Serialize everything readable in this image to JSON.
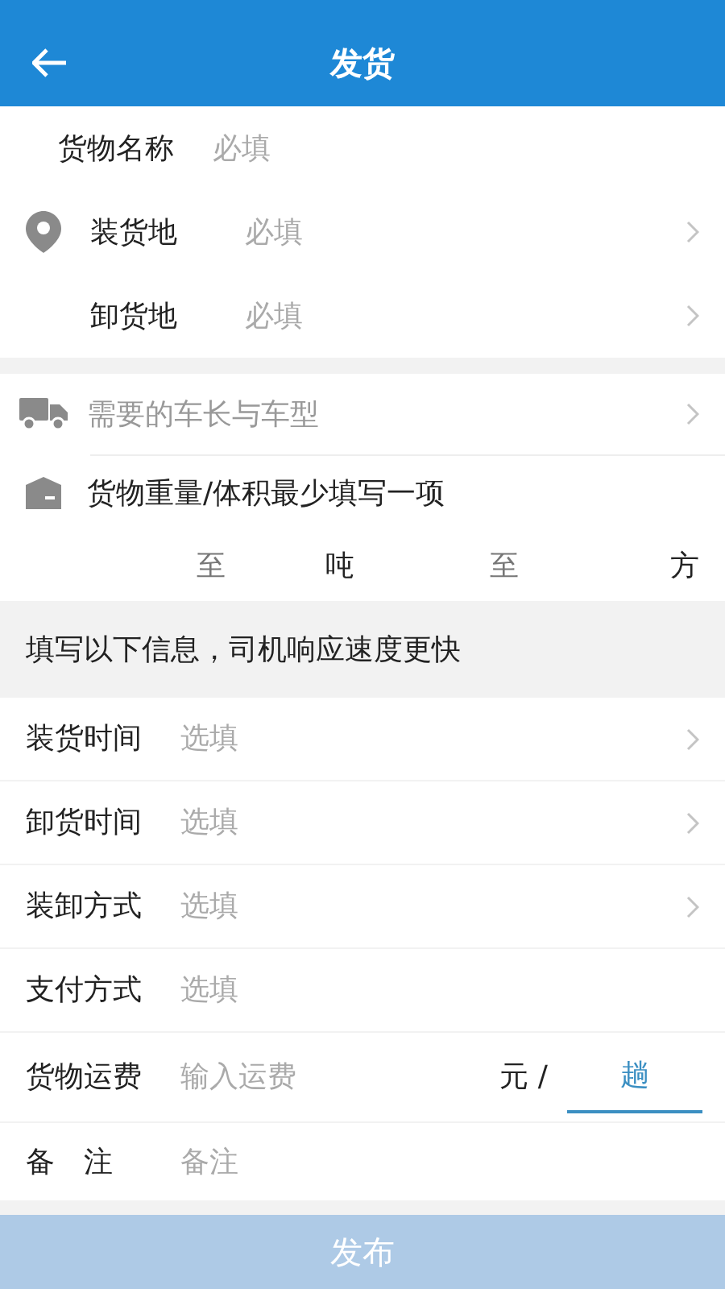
{
  "header": {
    "title": "发货"
  },
  "address_section": [
    {
      "kind": "plain",
      "label": "货物名称",
      "placeholder": "必填",
      "chevron": false
    },
    {
      "kind": "pin",
      "label": "装货地",
      "placeholder": "必填",
      "chevron": true
    },
    {
      "kind": "plain",
      "label": "卸货地",
      "placeholder": "必填",
      "chevron": true
    }
  ],
  "vehicle": {
    "label": "需要的车长与车型"
  },
  "cargo": {
    "label": "货物重量/体积最少填写一项",
    "weight_to": "至",
    "weight_unit": "吨",
    "volume_to": "至",
    "volume_unit": "方"
  },
  "optional_header": "填写以下信息，司机响应速度更快",
  "optional_rows": [
    {
      "label": "装货时间",
      "placeholder": "选填",
      "chevron": true
    },
    {
      "label": "卸货时间",
      "placeholder": "选填",
      "chevron": true
    },
    {
      "label": "装卸方式",
      "placeholder": "选填",
      "chevron": true
    },
    {
      "label": "支付方式",
      "placeholder": "选填",
      "chevron": false
    }
  ],
  "freight": {
    "label": "货物运费",
    "placeholder": "输入运费",
    "unit": "元 /",
    "per": "趟"
  },
  "remark": {
    "label": "备　注",
    "placeholder": "备注"
  },
  "submit": "发布"
}
